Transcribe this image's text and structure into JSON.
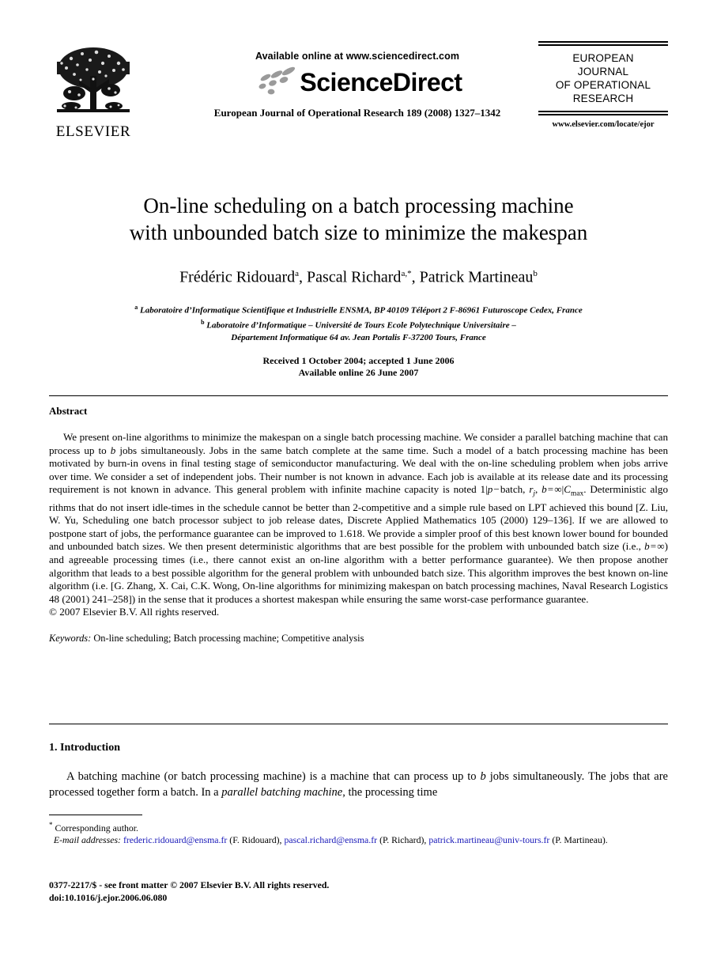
{
  "header": {
    "publisher_name": "ELSEVIER",
    "publisher_logo_icon": "elsevier-tree-logo",
    "available_online": "Available online at www.sciencedirect.com",
    "sciencedirect_word": "ScienceDirect",
    "sciencedirect_logo_icon": "sciencedirect-swoosh-icon",
    "journal_citation": "European Journal of Operational Research 189 (2008) 1327–1342",
    "journal_title_lines": [
      "EUROPEAN",
      "JOURNAL",
      "OF OPERATIONAL",
      "RESEARCH"
    ],
    "journal_title_full": "EUROPEAN JOURNAL OF OPERATIONAL RESEARCH",
    "journal_url": "www.elsevier.com/locate/ejor"
  },
  "article": {
    "title_line1": "On-line scheduling on a batch processing machine",
    "title_line2": "with unbounded batch size to minimize the makespan",
    "authors_plain": "Frédéric Ridouard a, Pascal Richard a,*, Patrick Martineau b",
    "authors": [
      {
        "name": "Frédéric Ridouard",
        "marks": "a"
      },
      {
        "name": "Pascal Richard",
        "marks": "a,*"
      },
      {
        "name": "Patrick Martineau",
        "marks": "b"
      }
    ],
    "affiliations": [
      {
        "mark": "a",
        "text": "Laboratoire d’Informatique Scientifique et Industrielle ENSMA, BP 40109 Téléport 2 F-86961 Futuroscope Cedex, France"
      },
      {
        "mark": "b",
        "text": "Laboratoire d’Informatique – Université de Tours Ecole Polytechnique Universitaire –"
      },
      {
        "mark": "",
        "text": "Département Informatique 64 av. Jean Portalis F-37200 Tours, France"
      }
    ],
    "received_line": "Received 1 October 2004; accepted 1 June 2006",
    "available_line": "Available online 26 June 2007"
  },
  "abstract": {
    "heading": "Abstract",
    "paragraph": "We present on-line algorithms to minimize the makespan on a single batch processing machine. We consider a parallel batching machine that can process up to b jobs simultaneously. Jobs in the same batch complete at the same time. Such a model of a batch processing machine has been motivated by burn-in ovens in final testing stage of semiconductor manufacturing. We deal with the on-line scheduling problem when jobs arrive over time. We consider a set of independent jobs. Their number is not known in advance. Each job is available at its release date and its processing requirement is not known in advance. This general problem with infinite machine capacity is noted 1|p − batch, rj, b = ∞|Cmax. Deterministic algorithms that do not insert idle-times in the schedule cannot be better than 2-competitive and a simple rule based on LPT achieved this bound [Z. Liu, W. Yu, Scheduling one batch processor subject to job release dates, Discrete Applied Mathematics 105 (2000) 129–136]. If we are allowed to postpone start of jobs, the performance guarantee can be improved to 1.618. We provide a simpler proof of this best known lower bound for bounded and unbounded batch sizes. We then present deterministic algorithms that are best possible for the problem with unbounded batch size (i.e., b = ∞) and agreeable processing times (i.e., there cannot exist an on-line algorithm with a better performance guarantee). We then propose another algorithm that leads to a best possible algorithm for the general problem with unbounded batch size. This algorithm improves the best known on-line algorithm (i.e. [G. Zhang, X. Cai, C.K. Wong, On-line algorithms for minimizing makespan on batch processing machines, Naval Research Logistics 48 (2001) 241–258]) in the sense that it produces a shortest makespan while ensuring the same worst-case performance guarantee.",
    "copyright": "© 2007 Elsevier B.V. All rights reserved.",
    "keywords_label": "Keywords:",
    "keywords_value": "On-line scheduling; Batch processing machine; Competitive analysis"
  },
  "introduction": {
    "heading": "1. Introduction",
    "paragraph": "A batching machine (or batch processing machine) is a machine that can process up to b jobs simultaneously. The jobs that are processed together form a batch. In a parallel batching machine, the processing time"
  },
  "footnotes": {
    "corresponding_mark": "*",
    "corresponding_text": "Corresponding author.",
    "email_label": "E-mail addresses:",
    "emails": [
      {
        "address": "frederic.ridouard@ensma.fr",
        "person": "(F. Ridouard),"
      },
      {
        "address": "pascal.richard@ensma.fr",
        "person": "(P. Richard),"
      },
      {
        "address": "patrick.martineau@univ-tours.fr",
        "person": "(P. Martineau)."
      }
    ],
    "issn_line": "0377-2217/$ - see front matter © 2007 Elsevier B.V. All rights reserved.",
    "doi_line": "doi:10.1016/j.ejor.2006.06.080"
  },
  "colors": {
    "link": "#1818b8",
    "text": "#000000",
    "background": "#ffffff"
  }
}
